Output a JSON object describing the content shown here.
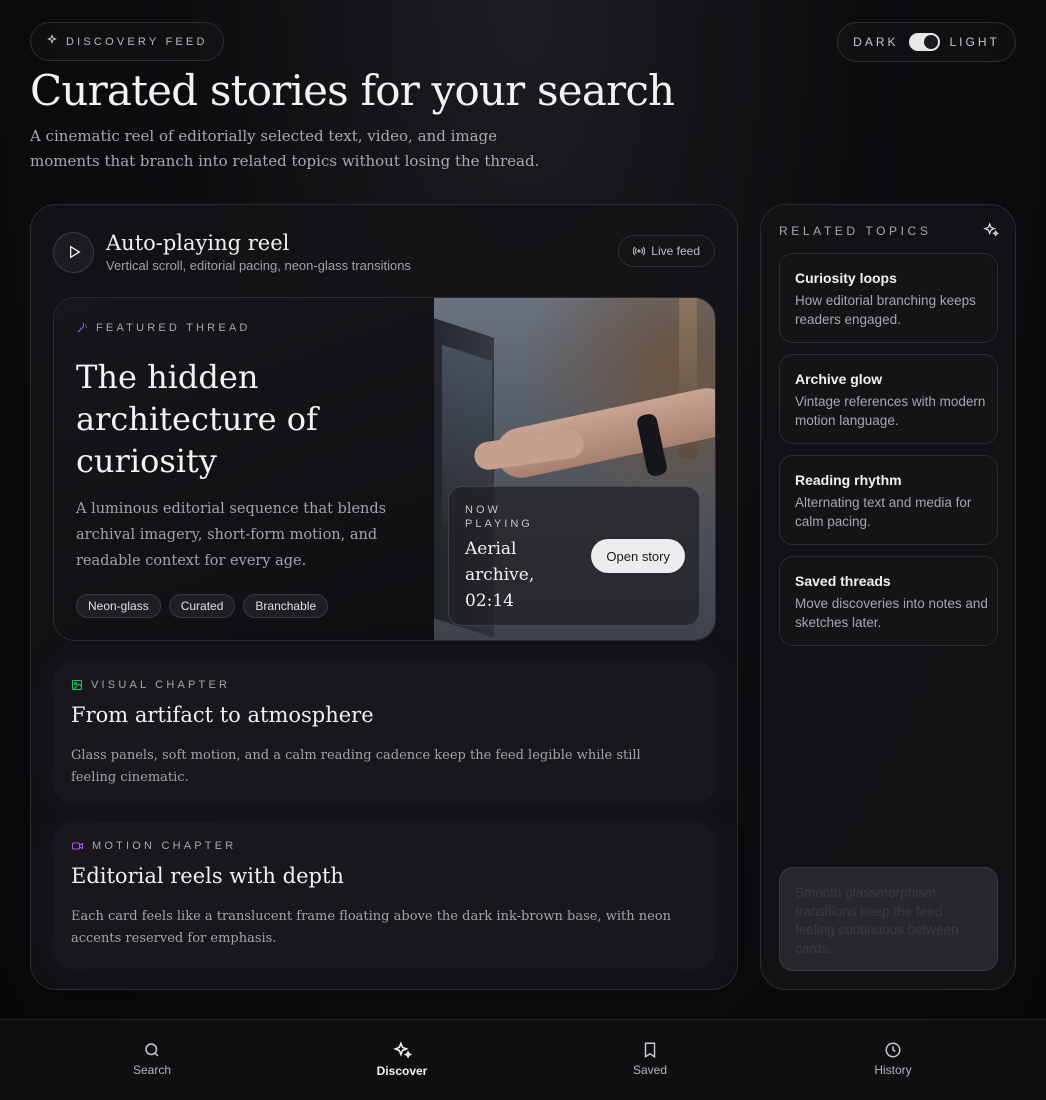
{
  "header": {
    "tag_label": "DISCOVERY FEED",
    "theme_dark_label": "DARK",
    "theme_light_label": "LIGHT",
    "title": "Curated stories for your search",
    "subtitle": "A cinematic reel of editorially selected text, video, and image moments that branch into related topics without losing the thread."
  },
  "reel": {
    "title": "Auto-playing reel",
    "subtitle": "Vertical scroll, editorial pacing, neon-glass transitions",
    "live_label": "Live feed",
    "featured": {
      "eyebrow": "FEATURED THREAD",
      "title": "The hidden architecture of curiosity",
      "description": "A luminous editorial sequence that blends archival imagery, short-form motion, and readable context for every age.",
      "tags": [
        "Neon-glass",
        "Curated",
        "Branchable"
      ],
      "now_playing_label": "NOW PLAYING",
      "now_playing_title": "Aerial archive, 02:14",
      "open_button": "Open story"
    },
    "chapters": [
      {
        "eyebrow": "VISUAL CHAPTER",
        "title": "From artifact to atmosphere",
        "description": "Glass panels, soft motion, and a calm reading cadence keep the feed legible while still feeling cinematic."
      },
      {
        "eyebrow": "MOTION CHAPTER",
        "title": "Editorial reels with depth",
        "description": "Each card feels like a translucent frame floating above the dark ink-brown base, with neon accents reserved for emphasis."
      }
    ]
  },
  "topics": {
    "heading": "RELATED TOPICS",
    "items": [
      {
        "title": "Curiosity loops",
        "description": "How editorial branching keeps readers engaged."
      },
      {
        "title": "Archive glow",
        "description": "Vintage references with modern motion language."
      },
      {
        "title": "Reading rhythm",
        "description": "Alternating text and media for calm pacing."
      },
      {
        "title": "Saved threads",
        "description": "Move discoveries into notes and sketches later."
      }
    ],
    "note": "Smooth glassmorphism transitions keep the feed feeling continuous between cards."
  },
  "nav": {
    "items": [
      {
        "label": "Search",
        "icon": "search-icon"
      },
      {
        "label": "Discover",
        "icon": "sparkles-icon",
        "active": true
      },
      {
        "label": "Saved",
        "icon": "bookmark-icon"
      },
      {
        "label": "History",
        "icon": "clock-icon"
      }
    ]
  },
  "colors": {
    "accent_purple": "#a855f7",
    "accent_green": "#22c55e",
    "background": "#0d0d10"
  }
}
